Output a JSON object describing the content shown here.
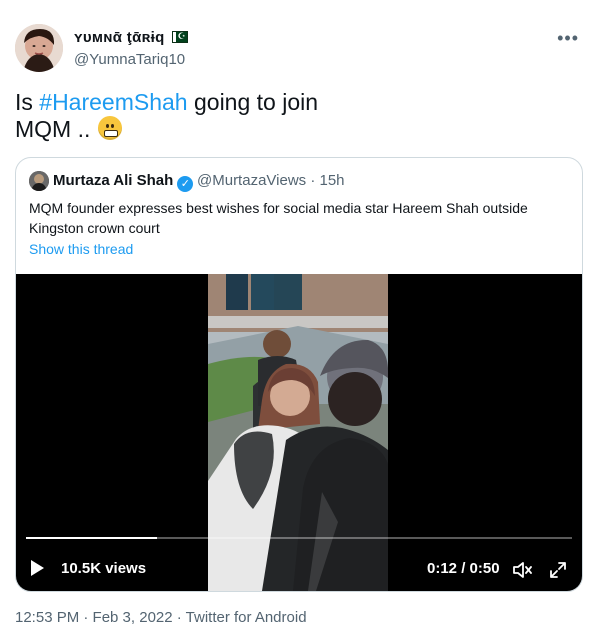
{
  "author": {
    "display_name": "ʏᴜᴍɴᾱ ţᾱʀɨq",
    "handle": "@YumnaTariq10"
  },
  "tweet": {
    "text_before": "Is ",
    "hashtag": "#HareemShah",
    "text_after": " going to join",
    "text_line2": "MQM .."
  },
  "quote": {
    "name": "Murtaza Ali Shah",
    "handle": "@MurtazaViews",
    "separator": " · ",
    "time": "15h",
    "text": "MQM founder expresses best wishes for social media star Hareem Shah outside Kingston crown court",
    "show_thread": "Show this thread"
  },
  "video": {
    "views": "10.5K views",
    "timestamp": "0:12 / 0:50",
    "progress": 0.24
  },
  "footer": {
    "timestamp": "12:53 PM · Feb 3, 2022 · Twitter for Android"
  },
  "colors": {
    "accent": "#1d9bf0",
    "text_primary": "#0f1419",
    "text_secondary": "#536471",
    "border": "#cfd9de"
  },
  "icons": {
    "more": "more-dots-icon",
    "verified": "verified-badge-icon",
    "play": "play-icon",
    "mute": "mute-icon",
    "fullscreen": "fullscreen-icon"
  }
}
